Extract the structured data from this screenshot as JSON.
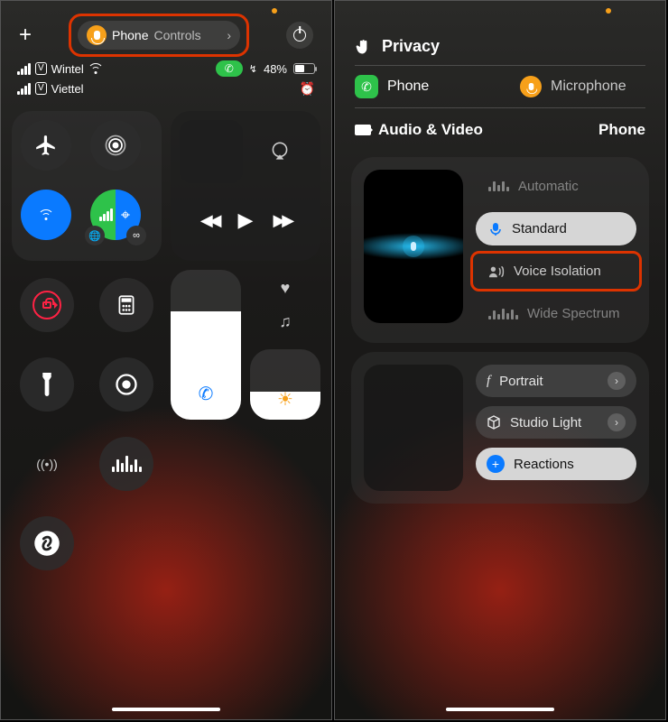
{
  "left": {
    "orange_dot": true,
    "phone_controls": {
      "label_phone": "Phone",
      "label_controls": "Controls"
    },
    "carriers": [
      "Wintel",
      "Viettel"
    ],
    "battery_percent": "48%",
    "call_active": true,
    "alarm_set": true,
    "media": {
      "prev": "◀◀",
      "play": "▶",
      "next": "▶▶"
    }
  },
  "right": {
    "privacy_header": "Privacy",
    "phone_label": "Phone",
    "microphone_label": "Microphone",
    "av_header": "Audio & Video",
    "av_app": "Phone",
    "mic_modes": {
      "automatic": "Automatic",
      "standard": "Standard",
      "voice_isolation": "Voice Isolation",
      "wide_spectrum": "Wide Spectrum",
      "selected": "standard"
    },
    "effects": {
      "portrait": "Portrait",
      "studio_light": "Studio Light",
      "reactions": "Reactions"
    }
  }
}
